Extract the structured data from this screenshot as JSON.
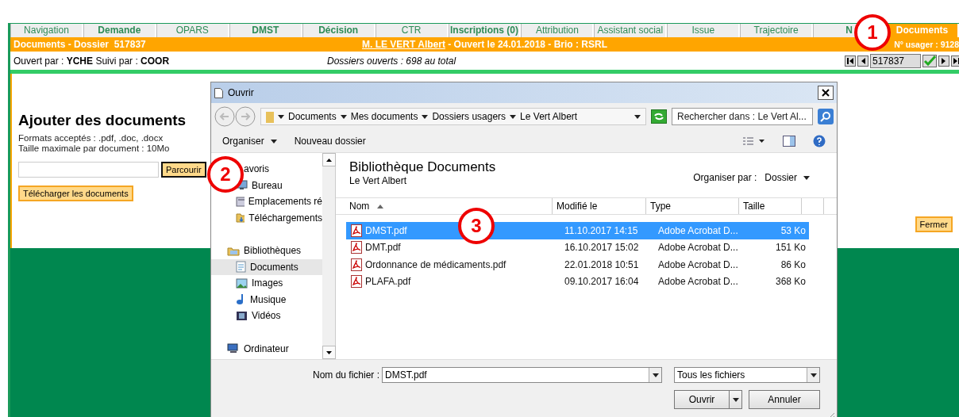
{
  "tabs": [
    {
      "label": "Navigation",
      "bold": false,
      "selected": false
    },
    {
      "label": "Demande",
      "bold": true,
      "selected": false
    },
    {
      "label": "OPARS",
      "bold": false,
      "selected": false
    },
    {
      "label": "DMST",
      "bold": true,
      "selected": false
    },
    {
      "label": "Décision",
      "bold": true,
      "selected": false
    },
    {
      "label": "CTR",
      "bold": false,
      "selected": false
    },
    {
      "label": "Inscriptions (0)",
      "bold": true,
      "selected": false
    },
    {
      "label": "Attribution",
      "bold": false,
      "selected": false
    },
    {
      "label": "Assistant social",
      "bold": false,
      "selected": false
    },
    {
      "label": "Issue",
      "bold": false,
      "selected": false
    },
    {
      "label": "Trajectoire",
      "bold": false,
      "selected": false
    },
    {
      "label": "N",
      "bold": true,
      "selected": false
    },
    {
      "label": "Documents",
      "bold": true,
      "selected": true
    }
  ],
  "header": {
    "title": "Documents - Dossier  517837",
    "patient": "M. LE VERT Albert",
    "details": " - Ouvert le 24.01.2018 - Brio : RSRL",
    "user_no": "N° usager : 9128"
  },
  "info": {
    "opened_by_label": "Ouvert par : ",
    "opened_by": "YCHE",
    "followed_label": " Suivi par : ",
    "followed_by": "COOR",
    "total": "Dossiers ouverts : 698 au total",
    "record_field": "517837"
  },
  "panel": {
    "heading": "Ajouter des documents",
    "formats": "Formats acceptés : .pdf, .doc, .docx",
    "max_size": "Taille maximale par document : 10Mo",
    "browse": "Parcourir",
    "upload": "Télécharger les documents",
    "close": "Fermer"
  },
  "dialog": {
    "title": "Ouvrir",
    "breadcrumb": [
      "Documents",
      "Mes documents",
      "Dossiers usagers",
      "Le Vert Albert"
    ],
    "search_placeholder": "Rechercher dans : Le Vert Al...",
    "toolbar": [
      "Organiser",
      "Nouveau dossier"
    ],
    "nav": [
      {
        "label": "avoris",
        "selected": false,
        "children": [
          {
            "label": "Bureau",
            "selected": false
          },
          {
            "label": "Emplacements ré",
            "selected": false
          },
          {
            "label": "Téléchargements",
            "selected": false
          }
        ]
      },
      {
        "label": "Bibliothèques",
        "selected": false,
        "children": [
          {
            "label": "Documents",
            "selected": true
          },
          {
            "label": "Images",
            "selected": false
          },
          {
            "label": "Musique",
            "selected": false
          },
          {
            "label": "Vidéos",
            "selected": false
          }
        ]
      },
      {
        "label": "Ordinateur",
        "selected": false
      }
    ],
    "library": {
      "title": "Bibliothèque Documents",
      "subtitle": "Le Vert Albert",
      "arrange_label": "Organiser par :",
      "arrange_value": "Dossier"
    },
    "columns": [
      {
        "label": "Nom",
        "sorted": true
      },
      {
        "label": "Modifié le",
        "sorted": false
      },
      {
        "label": "Type",
        "sorted": false
      },
      {
        "label": "Taille",
        "sorted": false
      }
    ],
    "files": [
      {
        "name": "DMST.pdf",
        "modified": "11.10.2017 14:15",
        "type": "Adobe Acrobat D...",
        "size": "53 Ko",
        "selected": true
      },
      {
        "name": "DMT.pdf",
        "modified": "16.10.2017 15:02",
        "type": "Adobe Acrobat D...",
        "size": "151 Ko",
        "selected": false
      },
      {
        "name": "Ordonnance de médicaments.pdf",
        "modified": "22.01.2018 10:51",
        "type": "Adobe Acrobat D...",
        "size": "86 Ko",
        "selected": false
      },
      {
        "name": "PLAFA.pdf",
        "modified": "09.10.2017 16:04",
        "type": "Adobe Acrobat D...",
        "size": "368 Ko",
        "selected": false
      }
    ],
    "filename_label": "Nom du fichier :",
    "filename": "DMST.pdf",
    "filter": "Tous les fichiers",
    "open": "Ouvrir",
    "cancel": "Annuler"
  },
  "annotations": [
    "1",
    "2",
    "3"
  ]
}
